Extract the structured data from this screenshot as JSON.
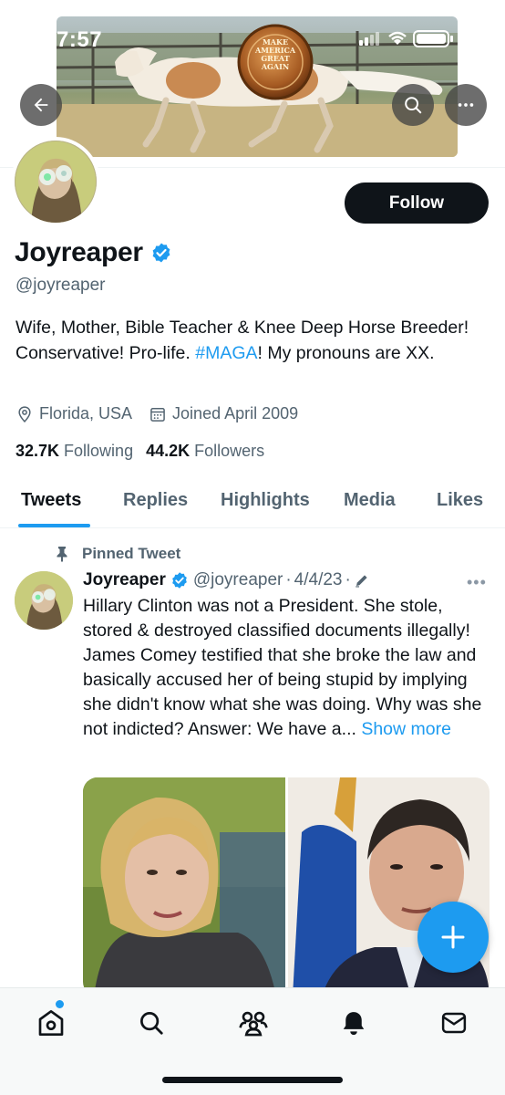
{
  "status_bar": {
    "time": "7:57"
  },
  "banner": {
    "badge_text": "MAKE AMERICA GREAT AGAIN"
  },
  "profile": {
    "name": "Joyreaper",
    "handle": "@joyreaper",
    "follow_label": "Follow",
    "bio_prefix": "Wife, Mother, Bible Teacher & Knee Deep Horse Breeder! Conservative! Pro-life. ",
    "bio_hashtag": "#MAGA",
    "bio_suffix": "! My pronouns are XX.",
    "location": "Florida, USA",
    "joined": "Joined April 2009",
    "following_count": "32.7K",
    "following_label": "Following",
    "followers_count": "44.2K",
    "followers_label": "Followers"
  },
  "tabs": [
    {
      "label": "Tweets",
      "active": true
    },
    {
      "label": "Replies",
      "active": false
    },
    {
      "label": "Highlights",
      "active": false
    },
    {
      "label": "Media",
      "active": false
    },
    {
      "label": "Likes",
      "active": false
    }
  ],
  "tweet": {
    "pinned_label": "Pinned Tweet",
    "name": "Joyreaper",
    "handle": "@joyreaper",
    "date": "4/4/23",
    "text": "Hillary Clinton was not a President. She stole, stored & destroyed classified documents illegally! James Comey testified that she broke the law and basically accused her of being stupid by implying she didn't know what she was doing. Why was she not indicted?  Answer: We have a... ",
    "show_more": "Show more"
  },
  "colors": {
    "accent": "#1d9bf0",
    "text_primary": "#0f1419",
    "text_secondary": "#536471",
    "follow_bg": "#0f1419"
  },
  "icons": {
    "back": "arrow-left-icon",
    "search": "search-icon",
    "more": "more-horizontal-icon",
    "verified": "verified-badge-icon",
    "location": "location-pin-icon",
    "calendar": "calendar-icon",
    "pin": "pin-icon",
    "edit": "edit-pencil-icon",
    "compose": "plus-icon",
    "nav": [
      "home-icon",
      "explore-search-icon",
      "communities-icon",
      "notifications-bell-icon",
      "messages-mail-icon"
    ]
  }
}
